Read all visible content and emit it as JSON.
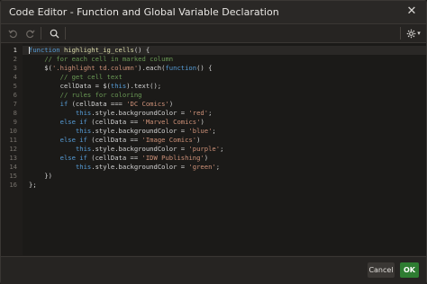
{
  "window": {
    "title": "Code Editor - Function and Global Variable Declaration",
    "close_label": "✕"
  },
  "toolbar": {
    "undo_icon": "undo-icon",
    "redo_icon": "redo-icon",
    "search_icon": "search-icon",
    "settings_icon": "gear-icon",
    "settings_chevron": "▾"
  },
  "editor": {
    "line_numbers": [
      "1",
      "2",
      "3",
      "4",
      "5",
      "6",
      "7",
      "8",
      "9",
      "10",
      "11",
      "12",
      "13",
      "14",
      "15",
      "16"
    ],
    "active_line": 1
  },
  "footer": {
    "cancel_label": "Cancel",
    "ok_label": "OK"
  }
}
